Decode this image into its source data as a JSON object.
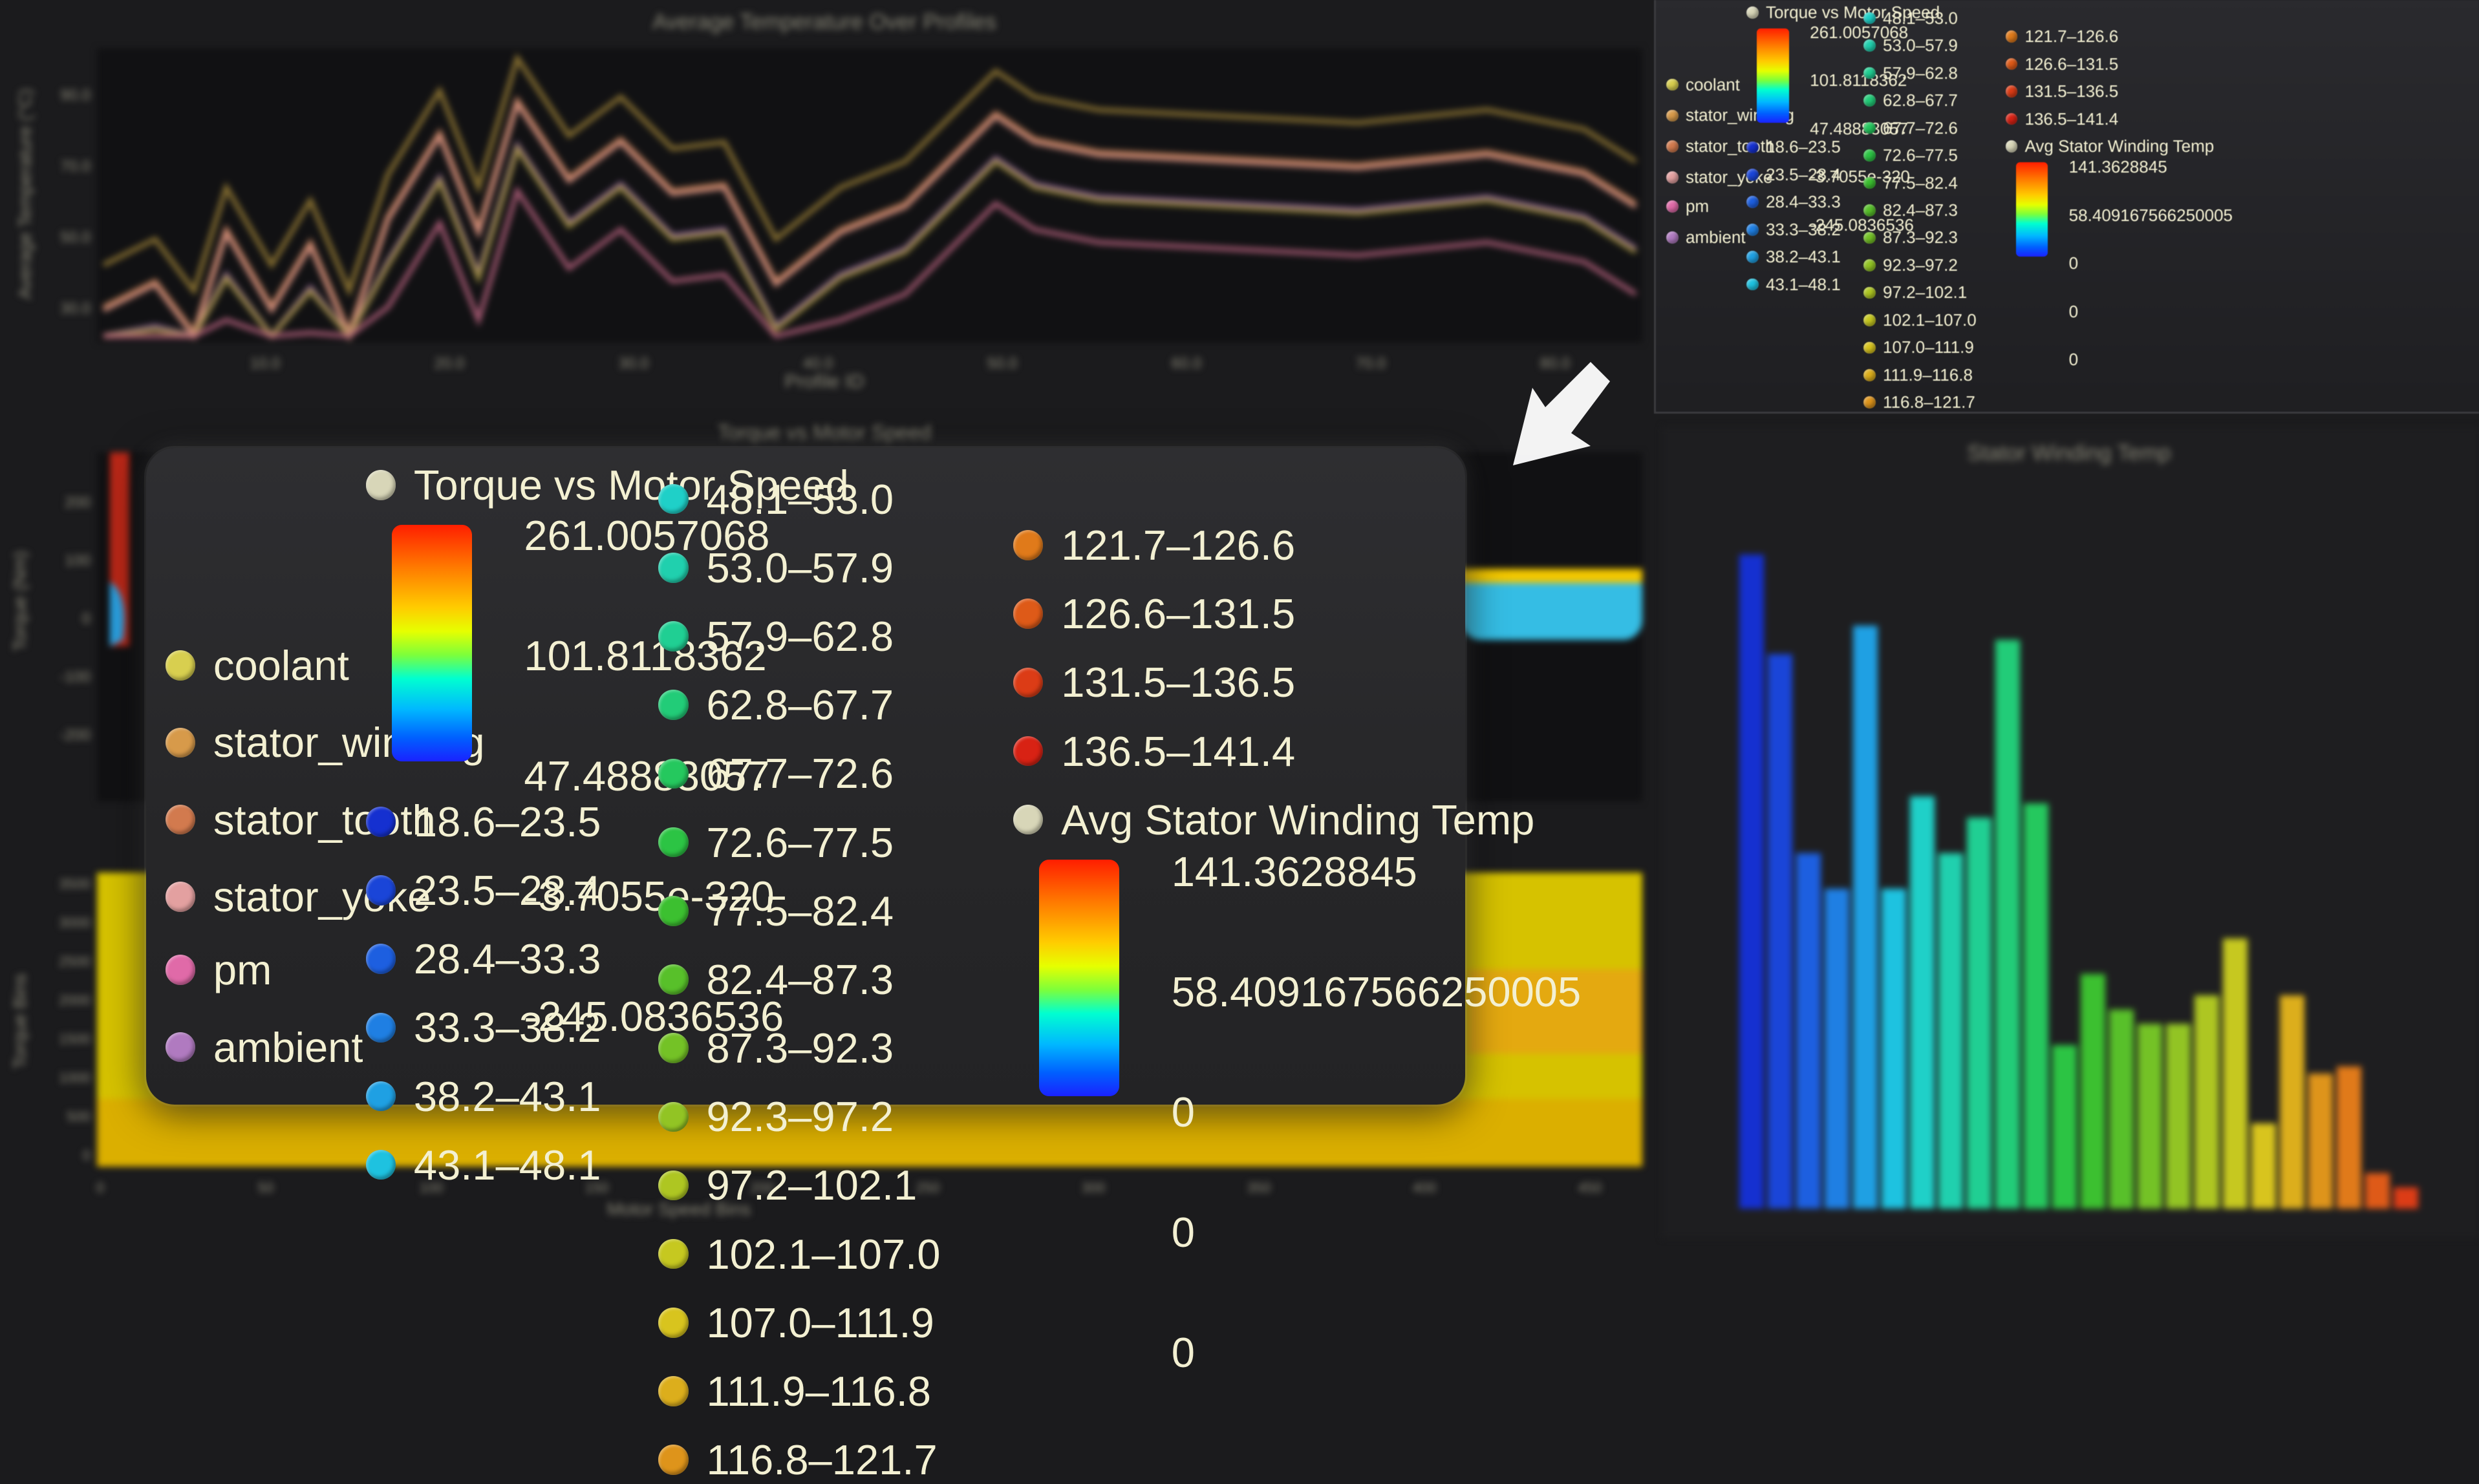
{
  "background": {
    "top_chart": {
      "title": "Average Temperature Over Profiles",
      "xlabel": "Profile ID",
      "ylabel": "Average Temperature (°C)",
      "yticks": [
        "90.0",
        "70.0",
        "50.0",
        "30.0"
      ],
      "xticks": [
        "10.0",
        "20.0",
        "30.0",
        "40.0",
        "50.0",
        "60.0",
        "70.0",
        "80.0"
      ]
    },
    "middle_chart": {
      "title": "Torque vs Motor Speed",
      "ylabel": "Torque (Nm)",
      "yticks": [
        "200",
        "100",
        "0",
        "-100",
        "-200"
      ]
    },
    "bottom_chart": {
      "xlabel": "Motor Speed Bins",
      "ylabel": "Torque Bins",
      "yticks": [
        "3500",
        "3000",
        "2500",
        "2000",
        "1500",
        "1000",
        "500",
        "0"
      ],
      "xticks": [
        "0",
        "50",
        "100",
        "150",
        "200",
        "250",
        "300",
        "350",
        "400",
        "450"
      ]
    },
    "right_chart": {
      "title": "Stator Winding Temp"
    }
  },
  "legend": {
    "series": [
      {
        "label": "coolant",
        "color": "#d8cf4f"
      },
      {
        "label": "stator_winding",
        "color": "#d79a4a"
      },
      {
        "label": "stator_tooth",
        "color": "#d27a4e"
      },
      {
        "label": "stator_yoke",
        "color": "#e3a0a0"
      },
      {
        "label": "pm",
        "color": "#e06aa8"
      },
      {
        "label": "ambient",
        "color": "#b07ac0"
      }
    ],
    "torque_title": "Torque vs Motor Speed",
    "torque_title_color": "#d8d6b8",
    "torque_ticks": [
      "261.0057068",
      "101.8118362",
      "47.48883057",
      "-3.7055e-320",
      "-245.0836536"
    ],
    "bins": [
      {
        "label": "18.6–23.5",
        "color": "#1530d0"
      },
      {
        "label": "23.5–28.4",
        "color": "#1a45d8"
      },
      {
        "label": "28.4–33.3",
        "color": "#1d5fe0"
      },
      {
        "label": "33.3–38.2",
        "color": "#1f7fe3"
      },
      {
        "label": "38.2–43.1",
        "color": "#1fa0e3"
      },
      {
        "label": "43.1–48.1",
        "color": "#1ec2e0"
      },
      {
        "label": "48.1–53.0",
        "color": "#1fd0c8"
      },
      {
        "label": "53.0–57.9",
        "color": "#20d0ae"
      },
      {
        "label": "57.9–62.8",
        "color": "#20cf93"
      },
      {
        "label": "62.8–67.7",
        "color": "#22cc78"
      },
      {
        "label": "67.7–72.6",
        "color": "#25c85e"
      },
      {
        "label": "72.6–77.5",
        "color": "#2cc444"
      },
      {
        "label": "77.5–82.4",
        "color": "#3cc030"
      },
      {
        "label": "82.4–87.3",
        "color": "#58c02a"
      },
      {
        "label": "87.3–92.3",
        "color": "#74c226"
      },
      {
        "label": "92.3–97.2",
        "color": "#92c424"
      },
      {
        "label": "97.2–102.1",
        "color": "#aec622"
      },
      {
        "label": "102.1–107.0",
        "color": "#c6c820"
      },
      {
        "label": "107.0–111.9",
        "color": "#d8c41e"
      },
      {
        "label": "111.9–116.8",
        "color": "#dcae1c"
      },
      {
        "label": "116.8–121.7",
        "color": "#de941b"
      },
      {
        "label": "121.7–126.6",
        "color": "#e07a1a"
      },
      {
        "label": "126.6–131.5",
        "color": "#de5a18"
      },
      {
        "label": "131.5–136.5",
        "color": "#dc3c16"
      },
      {
        "label": "136.5–141.4",
        "color": "#d82214"
      }
    ],
    "stator_title": "Avg Stator Winding Temp",
    "stator_title_color": "#d8d6b8",
    "stator_ticks": [
      "141.3628845",
      "58.409167566250005",
      "0",
      "0",
      "0"
    ]
  }
}
